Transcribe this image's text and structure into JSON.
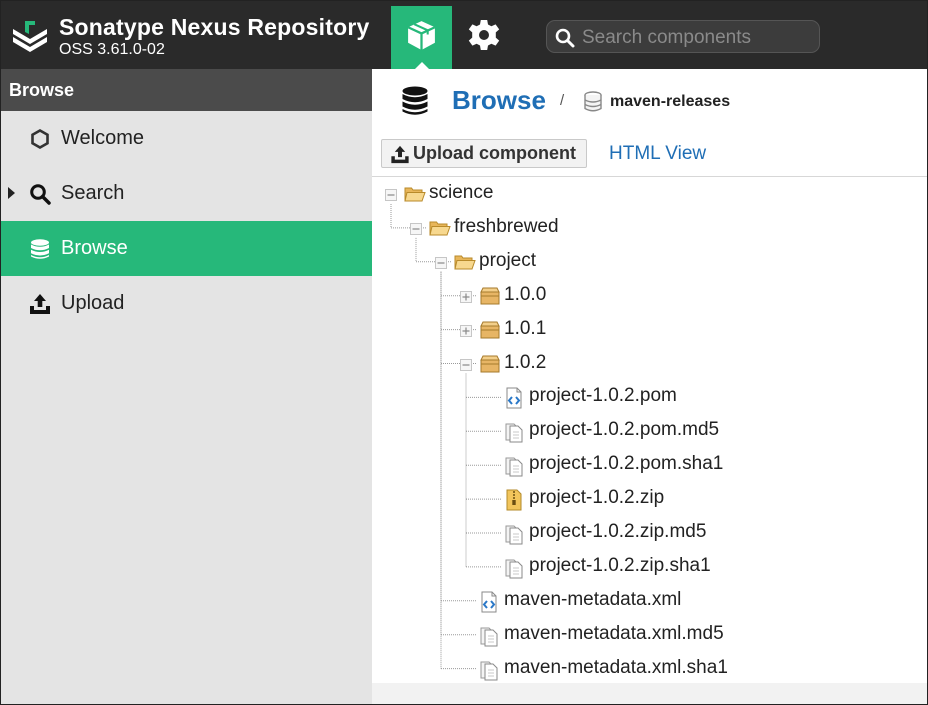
{
  "app": {
    "title": "Sonatype Nexus Repository",
    "version": "OSS 3.61.0-02"
  },
  "search": {
    "placeholder": "Search components"
  },
  "sidebar": {
    "header": "Browse",
    "items": [
      {
        "label": "Welcome",
        "icon": "hexagon-icon"
      },
      {
        "label": "Search",
        "icon": "search-icon"
      },
      {
        "label": "Browse",
        "icon": "database-icon",
        "active": true
      },
      {
        "label": "Upload",
        "icon": "upload-icon"
      }
    ]
  },
  "main": {
    "title": "Browse",
    "breadcrumb_separator": "/",
    "repository": "maven-releases",
    "upload_button": "Upload component",
    "html_view": "HTML View"
  },
  "tree": [
    {
      "label": "science",
      "type": "folder-open",
      "depth": 0,
      "expander": "minus"
    },
    {
      "label": "freshbrewed",
      "type": "folder-open",
      "depth": 1,
      "expander": "minus"
    },
    {
      "label": "project",
      "type": "folder-open",
      "depth": 2,
      "expander": "minus"
    },
    {
      "label": "1.0.0",
      "type": "package",
      "depth": 3,
      "expander": "plus"
    },
    {
      "label": "1.0.1",
      "type": "package",
      "depth": 3,
      "expander": "plus"
    },
    {
      "label": "1.0.2",
      "type": "package",
      "depth": 3,
      "expander": "minus"
    },
    {
      "label": "project-1.0.2.pom",
      "type": "xml-file",
      "depth": 4
    },
    {
      "label": "project-1.0.2.pom.md5",
      "type": "file",
      "depth": 4
    },
    {
      "label": "project-1.0.2.pom.sha1",
      "type": "file",
      "depth": 4
    },
    {
      "label": "project-1.0.2.zip",
      "type": "zip-file",
      "depth": 4
    },
    {
      "label": "project-1.0.2.zip.md5",
      "type": "file",
      "depth": 4
    },
    {
      "label": "project-1.0.2.zip.sha1",
      "type": "file",
      "depth": 4
    },
    {
      "label": "maven-metadata.xml",
      "type": "xml-file",
      "depth": 3
    },
    {
      "label": "maven-metadata.xml.md5",
      "type": "file",
      "depth": 3
    },
    {
      "label": "maven-metadata.xml.sha1",
      "type": "file",
      "depth": 3
    }
  ],
  "colors": {
    "topbar": "#2a2a2a",
    "accent_green": "#26b87a",
    "link_blue": "#1f6eb5",
    "sidebar_bg": "#e4e4e4",
    "sidebar_header": "#4b4b4b"
  }
}
